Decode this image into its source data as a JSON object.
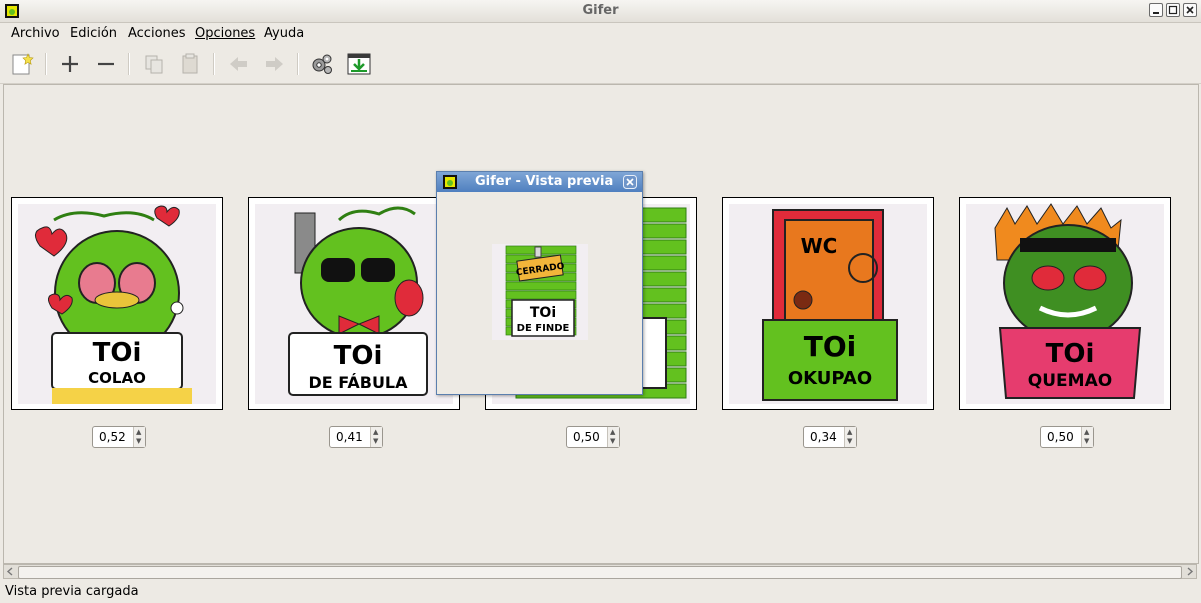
{
  "window": {
    "title": "Gifer",
    "min_icon": "minimize-icon",
    "max_icon": "maximize-icon",
    "close_icon": "close-icon"
  },
  "menu": {
    "items": [
      "Archivo",
      "Edición",
      "Acciones",
      "Opciones",
      "Ayuda"
    ]
  },
  "toolbar": {
    "icons": [
      "new-icon",
      "add-icon",
      "remove-icon",
      "copy-icon",
      "paste-icon",
      "back-icon",
      "forward-icon",
      "settings-icon",
      "export-icon"
    ]
  },
  "frames": [
    {
      "caption_top": "TOi",
      "caption_bottom": "COLAO",
      "delay": "0,52"
    },
    {
      "caption_top": "TOi",
      "caption_bottom": "DE FÁBULA",
      "delay": "0,41"
    },
    {
      "caption_top": "TOi",
      "caption_bottom": "DE FINDE",
      "delay": "0,50"
    },
    {
      "caption_top": "TOi",
      "caption_bottom": "OKUPAO",
      "sign": "WC",
      "delay": "0,34"
    },
    {
      "caption_top": "TOi",
      "caption_bottom": "QUEMAO",
      "delay": "0,50"
    }
  ],
  "preview": {
    "title": "Gifer - Vista previa",
    "sign": "CERRADO",
    "caption_top": "TOi",
    "caption_bottom": "DE FINDE"
  },
  "status": {
    "text": "Vista previa cargada"
  },
  "colors": {
    "green": "#63c11f",
    "dark_green": "#2f7f12",
    "red": "#e02b3a",
    "orange": "#e8781e",
    "pink": "#e63c6e",
    "titlebar_blue": "#4f7fbf"
  }
}
